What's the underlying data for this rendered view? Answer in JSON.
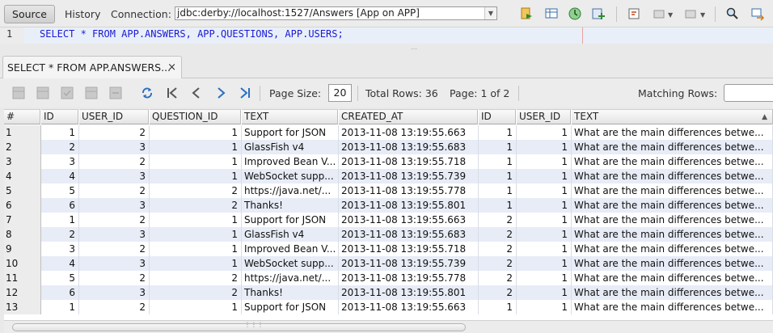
{
  "toolbar": {
    "source_tab": "Source",
    "history_tab": "History",
    "connection_label": "Connection:",
    "connection_value": "jdbc:derby://localhost:1527/Answers [App on APP]"
  },
  "editor": {
    "line_number": "1",
    "sql": "SELECT * FROM APP.ANSWERS, APP.QUESTIONS, APP.USERS;"
  },
  "result_tab": {
    "title": "SELECT * FROM APP.ANSWERS...",
    "close": "×"
  },
  "result_toolbar": {
    "page_size_label": "Page Size:",
    "page_size_value": "20",
    "total_rows": "Total Rows: 36",
    "page_info": "Page: 1 of 2",
    "matching_rows_label": "Matching Rows:"
  },
  "columns": [
    "#",
    "ID",
    "USER_ID",
    "QUESTION_ID",
    "TEXT",
    "CREATED_AT",
    "ID",
    "USER_ID",
    "TEXT"
  ],
  "rows": [
    [
      "1",
      "1",
      "2",
      "1",
      "Support for JSON",
      "2013-11-08 13:19:55.663",
      "1",
      "1",
      "What are the main differences betwe..."
    ],
    [
      "2",
      "2",
      "3",
      "1",
      "GlassFish v4",
      "2013-11-08 13:19:55.683",
      "1",
      "1",
      "What are the main differences betwe..."
    ],
    [
      "3",
      "3",
      "2",
      "1",
      "Improved Bean V...",
      "2013-11-08 13:19:55.718",
      "1",
      "1",
      "What are the main differences betwe..."
    ],
    [
      "4",
      "4",
      "3",
      "1",
      "WebSocket supp...",
      "2013-11-08 13:19:55.739",
      "1",
      "1",
      "What are the main differences betwe..."
    ],
    [
      "5",
      "5",
      "2",
      "2",
      "https://java.net/...",
      "2013-11-08 13:19:55.778",
      "1",
      "1",
      "What are the main differences betwe..."
    ],
    [
      "6",
      "6",
      "3",
      "2",
      "Thanks!",
      "2013-11-08 13:19:55.801",
      "1",
      "1",
      "What are the main differences betwe..."
    ],
    [
      "7",
      "1",
      "2",
      "1",
      "Support for JSON",
      "2013-11-08 13:19:55.663",
      "2",
      "1",
      "What are the main differences betwe..."
    ],
    [
      "8",
      "2",
      "3",
      "1",
      "GlassFish v4",
      "2013-11-08 13:19:55.683",
      "2",
      "1",
      "What are the main differences betwe..."
    ],
    [
      "9",
      "3",
      "2",
      "1",
      "Improved Bean V...",
      "2013-11-08 13:19:55.718",
      "2",
      "1",
      "What are the main differences betwe..."
    ],
    [
      "10",
      "4",
      "3",
      "1",
      "WebSocket supp...",
      "2013-11-08 13:19:55.739",
      "2",
      "1",
      "What are the main differences betwe..."
    ],
    [
      "11",
      "5",
      "2",
      "2",
      "https://java.net/...",
      "2013-11-08 13:19:55.778",
      "2",
      "1",
      "What are the main differences betwe..."
    ],
    [
      "12",
      "6",
      "3",
      "2",
      "Thanks!",
      "2013-11-08 13:19:55.801",
      "2",
      "1",
      "What are the main differences betwe..."
    ],
    [
      "13",
      "1",
      "2",
      "1",
      "Support for JSON",
      "2013-11-08 13:19:55.663",
      "1",
      "1",
      "What are the main differences betwe..."
    ]
  ],
  "colors": {
    "row_alt": "#e7ecf6",
    "keyword": "#1a1ad6",
    "identifier": "#0a8c3e"
  },
  "icons": [
    "run-sql-icon",
    "db-icon",
    "history-icon",
    "add-icon",
    "refresh-icon",
    "first-page-icon",
    "prev-page-icon",
    "next-page-icon",
    "last-page-icon",
    "search-icon"
  ]
}
